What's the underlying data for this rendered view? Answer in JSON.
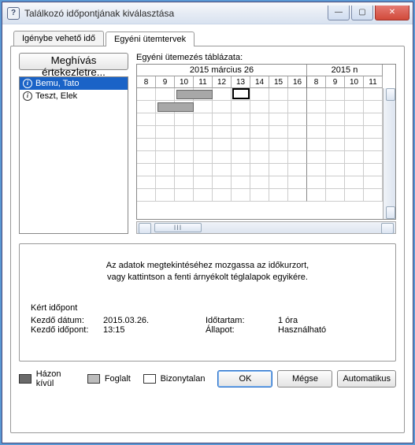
{
  "window": {
    "title": "Találkozó időpontjának kiválasztása"
  },
  "tabs": {
    "t1": "Igénybe vehető idő",
    "t2": "Egyéni ütemtervek"
  },
  "invite_label": "Meghívás értekezletre...",
  "table_label": "Egyéni ütemezés táblázata:",
  "attendees": [
    {
      "name": "Bemu, Tato"
    },
    {
      "name": "Teszt, Elek"
    }
  ],
  "days": {
    "d1": "2015 március 26",
    "d2": "2015 n"
  },
  "hours": {
    "h0": "8",
    "h1": "9",
    "h2": "10",
    "h3": "11",
    "h4": "12",
    "h5": "13",
    "h6": "14",
    "h7": "15",
    "h8": "16",
    "h9": "8",
    "h10": "9",
    "h11": "10",
    "h12": "11"
  },
  "hint1": "Az adatok megtekintéséhez mozgassa az időkurzort,",
  "hint2": "vagy kattintson a fenti árnyékolt téglalapok egyikére.",
  "req": {
    "title": "Kért időpont",
    "start_date_label": "Kezdő dátum:",
    "start_date_val": "2015.03.26.",
    "start_time_label": "Kezdő időpont:",
    "start_time_val": "13:15",
    "dur_label": "Időtartam:",
    "dur_val": "1 óra",
    "status_label": "Állapot:",
    "status_val": "Használható"
  },
  "legend": {
    "away": "Házon kívül",
    "busy": "Foglalt",
    "tent": "Bizonytalan"
  },
  "buttons": {
    "ok": "OK",
    "cancel": "Mégse",
    "auto": "Automatikus"
  }
}
